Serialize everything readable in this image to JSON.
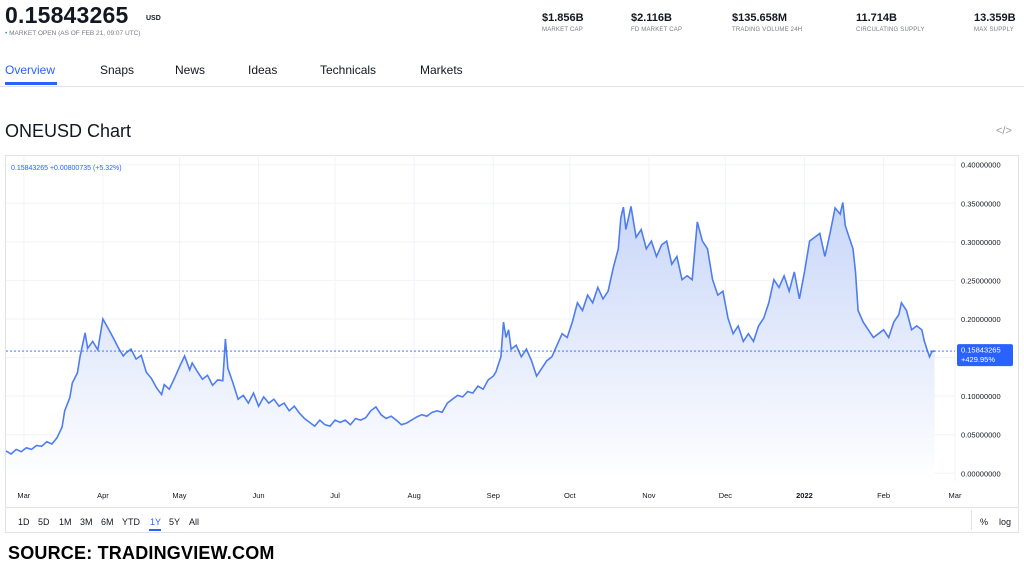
{
  "header": {
    "price": "0.15843265",
    "currency": "USD",
    "market_open_dot": "•",
    "market_status": "MARKET OPEN",
    "as_of": "(AS OF FEB 21, 09:07 UTC)",
    "stats": [
      {
        "value": "$1.856B",
        "label": "MARKET CAP"
      },
      {
        "value": "$2.116B",
        "label": "FD MARKET CAP"
      },
      {
        "value": "$135.658M",
        "label": "TRADING VOLUME 24H"
      },
      {
        "value": "11.714B",
        "label": "CIRCULATING SUPPLY"
      },
      {
        "value": "13.359B",
        "label": "MAX SUPPLY"
      }
    ]
  },
  "tabs": [
    "Overview",
    "Snaps",
    "News",
    "Ideas",
    "Technicals",
    "Markets"
  ],
  "active_tab": "Overview",
  "chart_title": "ONEUSD Chart",
  "embed_icon": "code-icon",
  "legend": {
    "price": "0.15843265",
    "change": "+0.00800735",
    "change_pct": "(+5.32%)"
  },
  "ranges": [
    "1D",
    "5D",
    "1M",
    "3M",
    "6M",
    "YTD",
    "1Y",
    "5Y",
    "All"
  ],
  "active_range": "1Y",
  "right_buttons": {
    "percent": "%",
    "log": "log"
  },
  "source": "SOURCE: TRADINGVIEW.COM",
  "colors": {
    "accent": "#2962ff",
    "line": "#4f7df0",
    "fill_top": "#c8d6f8",
    "fill_bottom": "#ffffff",
    "grid": "#f0f3fa"
  },
  "chart_data": {
    "type": "area",
    "title": "ONEUSD Chart",
    "xlabel": "",
    "ylabel": "",
    "ylim": [
      -0.01,
      0.41
    ],
    "y_ticks": [
      0.0,
      0.05,
      0.1,
      0.15,
      0.2,
      0.25,
      0.3,
      0.35,
      0.4
    ],
    "y_tick_labels": [
      "0.00000000",
      "0.05000000",
      "0.10000000",
      "0.15000000",
      "0.20000000",
      "0.25000000",
      "0.30000000",
      "0.35000000",
      "0.40000000"
    ],
    "x_ticks": [
      {
        "label": "Mar",
        "date": "2021-03-01"
      },
      {
        "label": "Apr",
        "date": "2021-04-01"
      },
      {
        "label": "May",
        "date": "2021-05-01"
      },
      {
        "label": "Jun",
        "date": "2021-06-01"
      },
      {
        "label": "Jul",
        "date": "2021-07-01"
      },
      {
        "label": "Aug",
        "date": "2021-08-01"
      },
      {
        "label": "Sep",
        "date": "2021-09-01"
      },
      {
        "label": "Oct",
        "date": "2021-10-01"
      },
      {
        "label": "Nov",
        "date": "2021-11-01"
      },
      {
        "label": "Dec",
        "date": "2021-12-01"
      },
      {
        "label": "2022",
        "date": "2022-01-01"
      },
      {
        "label": "Feb",
        "date": "2022-02-01"
      },
      {
        "label": "Mar",
        "date": "2022-03-01"
      }
    ],
    "last_price": {
      "value": 0.15843265,
      "label": "0.15843265",
      "change_label": "+429.95%"
    },
    "grid": true,
    "series": [
      {
        "values": [
          [
            "2021-02-22",
            0.029
          ],
          [
            "2021-02-24",
            0.025
          ],
          [
            "2021-02-26",
            0.031
          ],
          [
            "2021-02-28",
            0.028
          ],
          [
            "2021-03-02",
            0.033
          ],
          [
            "2021-03-04",
            0.031
          ],
          [
            "2021-03-06",
            0.036
          ],
          [
            "2021-03-08",
            0.035
          ],
          [
            "2021-03-10",
            0.041
          ],
          [
            "2021-03-12",
            0.038
          ],
          [
            "2021-03-14",
            0.046
          ],
          [
            "2021-03-16",
            0.06
          ],
          [
            "2021-03-17",
            0.081
          ],
          [
            "2021-03-19",
            0.098
          ],
          [
            "2021-03-20",
            0.117
          ],
          [
            "2021-03-22",
            0.13
          ],
          [
            "2021-03-23",
            0.151
          ],
          [
            "2021-03-25",
            0.182
          ],
          [
            "2021-03-26",
            0.162
          ],
          [
            "2021-03-28",
            0.171
          ],
          [
            "2021-03-30",
            0.16
          ],
          [
            "2021-04-01",
            0.2
          ],
          [
            "2021-04-02",
            0.194
          ],
          [
            "2021-04-04",
            0.182
          ],
          [
            "2021-04-05",
            0.176
          ],
          [
            "2021-04-07",
            0.163
          ],
          [
            "2021-04-09",
            0.152
          ],
          [
            "2021-04-10",
            0.156
          ],
          [
            "2021-04-12",
            0.161
          ],
          [
            "2021-04-14",
            0.148
          ],
          [
            "2021-04-16",
            0.153
          ],
          [
            "2021-04-18",
            0.131
          ],
          [
            "2021-04-20",
            0.123
          ],
          [
            "2021-04-22",
            0.111
          ],
          [
            "2021-04-24",
            0.102
          ],
          [
            "2021-04-25",
            0.115
          ],
          [
            "2021-04-27",
            0.109
          ],
          [
            "2021-04-29",
            0.123
          ],
          [
            "2021-05-01",
            0.138
          ],
          [
            "2021-05-03",
            0.152
          ],
          [
            "2021-05-05",
            0.134
          ],
          [
            "2021-05-06",
            0.143
          ],
          [
            "2021-05-08",
            0.132
          ],
          [
            "2021-05-10",
            0.122
          ],
          [
            "2021-05-12",
            0.127
          ],
          [
            "2021-05-14",
            0.114
          ],
          [
            "2021-05-16",
            0.121
          ],
          [
            "2021-05-18",
            0.12
          ],
          [
            "2021-05-19",
            0.174
          ],
          [
            "2021-05-20",
            0.136
          ],
          [
            "2021-05-22",
            0.117
          ],
          [
            "2021-05-24",
            0.096
          ],
          [
            "2021-05-26",
            0.101
          ],
          [
            "2021-05-28",
            0.091
          ],
          [
            "2021-05-30",
            0.104
          ],
          [
            "2021-06-01",
            0.087
          ],
          [
            "2021-06-03",
            0.099
          ],
          [
            "2021-06-05",
            0.091
          ],
          [
            "2021-06-07",
            0.096
          ],
          [
            "2021-06-09",
            0.087
          ],
          [
            "2021-06-11",
            0.091
          ],
          [
            "2021-06-13",
            0.081
          ],
          [
            "2021-06-15",
            0.087
          ],
          [
            "2021-06-17",
            0.078
          ],
          [
            "2021-06-19",
            0.071
          ],
          [
            "2021-06-21",
            0.066
          ],
          [
            "2021-06-23",
            0.061
          ],
          [
            "2021-06-25",
            0.069
          ],
          [
            "2021-06-27",
            0.063
          ],
          [
            "2021-06-29",
            0.061
          ],
          [
            "2021-07-01",
            0.069
          ],
          [
            "2021-07-03",
            0.066
          ],
          [
            "2021-07-05",
            0.069
          ],
          [
            "2021-07-07",
            0.063
          ],
          [
            "2021-07-09",
            0.071
          ],
          [
            "2021-07-11",
            0.069
          ],
          [
            "2021-07-13",
            0.072
          ],
          [
            "2021-07-15",
            0.081
          ],
          [
            "2021-07-17",
            0.086
          ],
          [
            "2021-07-19",
            0.076
          ],
          [
            "2021-07-21",
            0.071
          ],
          [
            "2021-07-23",
            0.074
          ],
          [
            "2021-07-25",
            0.069
          ],
          [
            "2021-07-27",
            0.063
          ],
          [
            "2021-07-29",
            0.065
          ],
          [
            "2021-07-31",
            0.069
          ],
          [
            "2021-08-02",
            0.073
          ],
          [
            "2021-08-04",
            0.076
          ],
          [
            "2021-08-06",
            0.074
          ],
          [
            "2021-08-08",
            0.079
          ],
          [
            "2021-08-10",
            0.081
          ],
          [
            "2021-08-12",
            0.079
          ],
          [
            "2021-08-14",
            0.091
          ],
          [
            "2021-08-16",
            0.096
          ],
          [
            "2021-08-18",
            0.101
          ],
          [
            "2021-08-20",
            0.099
          ],
          [
            "2021-08-22",
            0.106
          ],
          [
            "2021-08-24",
            0.104
          ],
          [
            "2021-08-26",
            0.113
          ],
          [
            "2021-08-28",
            0.109
          ],
          [
            "2021-08-30",
            0.121
          ],
          [
            "2021-09-01",
            0.126
          ],
          [
            "2021-09-02",
            0.131
          ],
          [
            "2021-09-04",
            0.151
          ],
          [
            "2021-09-05",
            0.196
          ],
          [
            "2021-09-06",
            0.176
          ],
          [
            "2021-09-07",
            0.186
          ],
          [
            "2021-09-08",
            0.161
          ],
          [
            "2021-09-10",
            0.166
          ],
          [
            "2021-09-12",
            0.151
          ],
          [
            "2021-09-14",
            0.161
          ],
          [
            "2021-09-16",
            0.146
          ],
          [
            "2021-09-18",
            0.126
          ],
          [
            "2021-09-20",
            0.136
          ],
          [
            "2021-09-22",
            0.146
          ],
          [
            "2021-09-24",
            0.151
          ],
          [
            "2021-09-26",
            0.166
          ],
          [
            "2021-09-28",
            0.181
          ],
          [
            "2021-09-30",
            0.176
          ],
          [
            "2021-10-02",
            0.196
          ],
          [
            "2021-10-04",
            0.221
          ],
          [
            "2021-10-06",
            0.211
          ],
          [
            "2021-10-08",
            0.231
          ],
          [
            "2021-10-10",
            0.221
          ],
          [
            "2021-10-12",
            0.241
          ],
          [
            "2021-10-14",
            0.226
          ],
          [
            "2021-10-16",
            0.236
          ],
          [
            "2021-10-18",
            0.266
          ],
          [
            "2021-10-20",
            0.291
          ],
          [
            "2021-10-21",
            0.331
          ],
          [
            "2021-10-22",
            0.345
          ],
          [
            "2021-10-23",
            0.316
          ],
          [
            "2021-10-25",
            0.346
          ],
          [
            "2021-10-27",
            0.306
          ],
          [
            "2021-10-29",
            0.316
          ],
          [
            "2021-10-31",
            0.291
          ],
          [
            "2021-11-02",
            0.301
          ],
          [
            "2021-11-04",
            0.281
          ],
          [
            "2021-11-06",
            0.296
          ],
          [
            "2021-11-08",
            0.301
          ],
          [
            "2021-11-10",
            0.271
          ],
          [
            "2021-11-12",
            0.281
          ],
          [
            "2021-11-14",
            0.251
          ],
          [
            "2021-11-16",
            0.256
          ],
          [
            "2021-11-18",
            0.251
          ],
          [
            "2021-11-20",
            0.326
          ],
          [
            "2021-11-22",
            0.301
          ],
          [
            "2021-11-24",
            0.291
          ],
          [
            "2021-11-26",
            0.251
          ],
          [
            "2021-11-28",
            0.231
          ],
          [
            "2021-11-30",
            0.236
          ],
          [
            "2021-12-02",
            0.201
          ],
          [
            "2021-12-04",
            0.181
          ],
          [
            "2021-12-06",
            0.191
          ],
          [
            "2021-12-08",
            0.171
          ],
          [
            "2021-12-10",
            0.181
          ],
          [
            "2021-12-12",
            0.171
          ],
          [
            "2021-12-14",
            0.191
          ],
          [
            "2021-12-16",
            0.201
          ],
          [
            "2021-12-18",
            0.221
          ],
          [
            "2021-12-20",
            0.251
          ],
          [
            "2021-12-22",
            0.241
          ],
          [
            "2021-12-24",
            0.256
          ],
          [
            "2021-12-26",
            0.236
          ],
          [
            "2021-12-28",
            0.261
          ],
          [
            "2021-12-30",
            0.226
          ],
          [
            "2022-01-01",
            0.261
          ],
          [
            "2022-01-03",
            0.301
          ],
          [
            "2022-01-05",
            0.306
          ],
          [
            "2022-01-07",
            0.311
          ],
          [
            "2022-01-09",
            0.281
          ],
          [
            "2022-01-11",
            0.311
          ],
          [
            "2022-01-13",
            0.344
          ],
          [
            "2022-01-15",
            0.336
          ],
          [
            "2022-01-16",
            0.351
          ],
          [
            "2022-01-17",
            0.321
          ],
          [
            "2022-01-19",
            0.301
          ],
          [
            "2022-01-20",
            0.291
          ],
          [
            "2022-01-21",
            0.261
          ],
          [
            "2022-01-22",
            0.211
          ],
          [
            "2022-01-24",
            0.196
          ],
          [
            "2022-01-26",
            0.186
          ],
          [
            "2022-01-28",
            0.176
          ],
          [
            "2022-01-30",
            0.181
          ],
          [
            "2022-02-01",
            0.186
          ],
          [
            "2022-02-03",
            0.176
          ],
          [
            "2022-02-05",
            0.196
          ],
          [
            "2022-02-07",
            0.206
          ],
          [
            "2022-02-08",
            0.221
          ],
          [
            "2022-02-10",
            0.211
          ],
          [
            "2022-02-12",
            0.186
          ],
          [
            "2022-02-14",
            0.191
          ],
          [
            "2022-02-16",
            0.186
          ],
          [
            "2022-02-17",
            0.171
          ],
          [
            "2022-02-18",
            0.161
          ],
          [
            "2022-02-19",
            0.151
          ],
          [
            "2022-02-20",
            0.158
          ],
          [
            "2022-02-21",
            0.15843265
          ]
        ]
      }
    ]
  }
}
